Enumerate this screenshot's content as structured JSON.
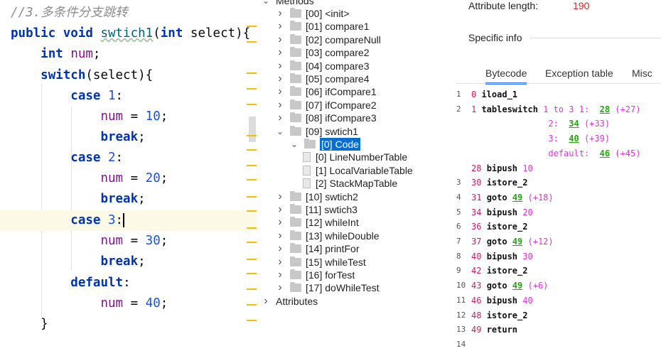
{
  "editor": {
    "lines": [
      [
        {
          "t": "//3.多条件分支跳转",
          "c": "cm"
        }
      ],
      [
        {
          "t": "public ",
          "c": "kw"
        },
        {
          "t": "void ",
          "c": "kw"
        },
        {
          "t": "swtich1",
          "c": "fn"
        },
        {
          "t": "(",
          "c": "plain"
        },
        {
          "t": "int ",
          "c": "kw"
        },
        {
          "t": "select){",
          "c": "plain"
        }
      ],
      [
        {
          "t": "    ",
          "c": "plain"
        },
        {
          "t": "int ",
          "c": "kw"
        },
        {
          "t": "num",
          "c": "var"
        },
        {
          "t": ";",
          "c": "plain"
        }
      ],
      [
        {
          "t": "    ",
          "c": "plain"
        },
        {
          "t": "switch",
          "c": "kw"
        },
        {
          "t": "(select){",
          "c": "plain"
        }
      ],
      [
        {
          "t": "        ",
          "c": "plain"
        },
        {
          "t": "case ",
          "c": "kw"
        },
        {
          "t": "1",
          "c": "num"
        },
        {
          "t": ":",
          "c": "plain"
        }
      ],
      [
        {
          "t": "            ",
          "c": "plain"
        },
        {
          "t": "num",
          "c": "var"
        },
        {
          "t": " = ",
          "c": "plain"
        },
        {
          "t": "10",
          "c": "num"
        },
        {
          "t": ";",
          "c": "plain"
        }
      ],
      [
        {
          "t": "            ",
          "c": "plain"
        },
        {
          "t": "break",
          "c": "kw"
        },
        {
          "t": ";",
          "c": "plain"
        }
      ],
      [
        {
          "t": "        ",
          "c": "plain"
        },
        {
          "t": "case ",
          "c": "kw"
        },
        {
          "t": "2",
          "c": "num"
        },
        {
          "t": ":",
          "c": "plain"
        }
      ],
      [
        {
          "t": "            ",
          "c": "plain"
        },
        {
          "t": "num",
          "c": "var"
        },
        {
          "t": " = ",
          "c": "plain"
        },
        {
          "t": "20",
          "c": "num"
        },
        {
          "t": ";",
          "c": "plain"
        }
      ],
      [
        {
          "t": "            ",
          "c": "plain"
        },
        {
          "t": "break",
          "c": "kw"
        },
        {
          "t": ";",
          "c": "plain"
        }
      ],
      [
        {
          "t": "        ",
          "c": "plain"
        },
        {
          "t": "case ",
          "c": "kw"
        },
        {
          "t": "3",
          "c": "num"
        },
        {
          "t": ":",
          "c": "plain"
        }
      ],
      [
        {
          "t": "            ",
          "c": "plain"
        },
        {
          "t": "num",
          "c": "var"
        },
        {
          "t": " = ",
          "c": "plain"
        },
        {
          "t": "30",
          "c": "num"
        },
        {
          "t": ";",
          "c": "plain"
        }
      ],
      [
        {
          "t": "            ",
          "c": "plain"
        },
        {
          "t": "break",
          "c": "kw"
        },
        {
          "t": ";",
          "c": "plain"
        }
      ],
      [
        {
          "t": "        ",
          "c": "plain"
        },
        {
          "t": "default",
          "c": "kw"
        },
        {
          "t": ":",
          "c": "plain"
        }
      ],
      [
        {
          "t": "            ",
          "c": "plain"
        },
        {
          "t": "num",
          "c": "var"
        },
        {
          "t": " = ",
          "c": "plain"
        },
        {
          "t": "40",
          "c": "num"
        },
        {
          "t": ";",
          "c": "plain"
        }
      ],
      [
        {
          "t": "    }",
          "c": "plain"
        }
      ]
    ],
    "current_line": 10
  },
  "tree": {
    "header": "Methods",
    "items": [
      {
        "label": "[00] <init>",
        "level": 1,
        "kind": "folder",
        "state": "collapsed"
      },
      {
        "label": "[01] compare1",
        "level": 1,
        "kind": "folder",
        "state": "collapsed"
      },
      {
        "label": "[02] compareNull",
        "level": 1,
        "kind": "folder",
        "state": "collapsed"
      },
      {
        "label": "[03] compare2",
        "level": 1,
        "kind": "folder",
        "state": "collapsed"
      },
      {
        "label": "[04] compare3",
        "level": 1,
        "kind": "folder",
        "state": "collapsed"
      },
      {
        "label": "[05] compare4",
        "level": 1,
        "kind": "folder",
        "state": "collapsed"
      },
      {
        "label": "[06] ifCompare1",
        "level": 1,
        "kind": "folder",
        "state": "collapsed"
      },
      {
        "label": "[07] ifCompare2",
        "level": 1,
        "kind": "folder",
        "state": "collapsed"
      },
      {
        "label": "[08] ifCompare3",
        "level": 1,
        "kind": "folder",
        "state": "collapsed"
      },
      {
        "label": "[09] swtich1",
        "level": 1,
        "kind": "folder",
        "state": "expanded"
      },
      {
        "label": "[0] Code",
        "level": 2,
        "kind": "folder",
        "state": "expanded",
        "selected": true
      },
      {
        "label": "[0] LineNumberTable",
        "level": 3,
        "kind": "doc",
        "state": "leaf"
      },
      {
        "label": "[1] LocalVariableTable",
        "level": 3,
        "kind": "doc",
        "state": "leaf"
      },
      {
        "label": "[2] StackMapTable",
        "level": 3,
        "kind": "doc",
        "state": "leaf"
      },
      {
        "label": "[10] swtich2",
        "level": 1,
        "kind": "folder",
        "state": "collapsed"
      },
      {
        "label": "[11] swtich3",
        "level": 1,
        "kind": "folder",
        "state": "collapsed"
      },
      {
        "label": "[12] whileInt",
        "level": 1,
        "kind": "folder",
        "state": "collapsed"
      },
      {
        "label": "[13] whileDouble",
        "level": 1,
        "kind": "folder",
        "state": "collapsed"
      },
      {
        "label": "[14] printFor",
        "level": 1,
        "kind": "folder",
        "state": "collapsed"
      },
      {
        "label": "[15] whileTest",
        "level": 1,
        "kind": "folder",
        "state": "collapsed"
      },
      {
        "label": "[16] forTest",
        "level": 1,
        "kind": "folder",
        "state": "collapsed"
      },
      {
        "label": "[17] doWhileTest",
        "level": 1,
        "kind": "folder",
        "state": "collapsed"
      },
      {
        "label": "Attributes",
        "level": 0,
        "kind": "none",
        "state": "collapsed"
      }
    ]
  },
  "details": {
    "attribute_length_label": "Attribute length:",
    "attribute_length_value": "190",
    "specific_info_label": "Specific info",
    "tabs": [
      "Bytecode",
      "Exception table",
      "Misc"
    ],
    "active_tab": "Bytecode",
    "bytecode": [
      {
        "ln": "1",
        "parts": [
          {
            "t": "0 ",
            "c": "off"
          },
          {
            "t": "iload_1",
            "c": "op"
          }
        ]
      },
      {
        "ln": "2",
        "parts": [
          {
            "t": "1 ",
            "c": "off"
          },
          {
            "t": "tableswitch ",
            "c": "op"
          },
          {
            "t": "1 to 3 1:  ",
            "c": "arg"
          },
          {
            "t": "28",
            "c": "lnk"
          },
          {
            "t": " (+27)",
            "c": "rel"
          }
        ]
      },
      {
        "ln": "",
        "parts": [
          {
            "t": "               2:  ",
            "c": "arg"
          },
          {
            "t": "34",
            "c": "lnk"
          },
          {
            "t": " (+33)",
            "c": "rel"
          }
        ]
      },
      {
        "ln": "",
        "parts": [
          {
            "t": "               3:  ",
            "c": "arg"
          },
          {
            "t": "40",
            "c": "lnk"
          },
          {
            "t": " (+39)",
            "c": "rel"
          }
        ]
      },
      {
        "ln": "",
        "parts": [
          {
            "t": "               default:  ",
            "c": "arg"
          },
          {
            "t": "46",
            "c": "lnk"
          },
          {
            "t": " (+45)",
            "c": "rel"
          }
        ]
      },
      {
        "ln": "",
        "parts": [
          {
            "t": "28 ",
            "c": "off"
          },
          {
            "t": "bipush ",
            "c": "op"
          },
          {
            "t": "10",
            "c": "arg"
          }
        ]
      },
      {
        "ln": "3",
        "parts": [
          {
            "t": "30 ",
            "c": "off"
          },
          {
            "t": "istore_2",
            "c": "op"
          }
        ]
      },
      {
        "ln": "4",
        "parts": [
          {
            "t": "31 ",
            "c": "off"
          },
          {
            "t": "goto ",
            "c": "op"
          },
          {
            "t": "49",
            "c": "lnk"
          },
          {
            "t": " (+18)",
            "c": "rel"
          }
        ]
      },
      {
        "ln": "5",
        "parts": [
          {
            "t": "34 ",
            "c": "off"
          },
          {
            "t": "bipush ",
            "c": "op"
          },
          {
            "t": "20",
            "c": "arg"
          }
        ]
      },
      {
        "ln": "6",
        "parts": [
          {
            "t": "36 ",
            "c": "off"
          },
          {
            "t": "istore_2",
            "c": "op"
          }
        ]
      },
      {
        "ln": "7",
        "parts": [
          {
            "t": "37 ",
            "c": "off"
          },
          {
            "t": "goto ",
            "c": "op"
          },
          {
            "t": "49",
            "c": "lnk"
          },
          {
            "t": " (+12)",
            "c": "rel"
          }
        ]
      },
      {
        "ln": "8",
        "parts": [
          {
            "t": "40 ",
            "c": "off"
          },
          {
            "t": "bipush ",
            "c": "op"
          },
          {
            "t": "30",
            "c": "arg"
          }
        ]
      },
      {
        "ln": "9",
        "parts": [
          {
            "t": "42 ",
            "c": "off"
          },
          {
            "t": "istore_2",
            "c": "op"
          }
        ]
      },
      {
        "ln": "10",
        "parts": [
          {
            "t": "43 ",
            "c": "off"
          },
          {
            "t": "goto ",
            "c": "op"
          },
          {
            "t": "49",
            "c": "lnk"
          },
          {
            "t": " (+6)",
            "c": "rel"
          }
        ]
      },
      {
        "ln": "11",
        "parts": [
          {
            "t": "46 ",
            "c": "off"
          },
          {
            "t": "bipush ",
            "c": "op"
          },
          {
            "t": "40",
            "c": "arg"
          }
        ]
      },
      {
        "ln": "12",
        "parts": [
          {
            "t": "48 ",
            "c": "off"
          },
          {
            "t": "istore_2",
            "c": "op"
          }
        ]
      },
      {
        "ln": "13",
        "parts": [
          {
            "t": "49 ",
            "c": "off"
          },
          {
            "t": "return",
            "c": "op"
          }
        ]
      },
      {
        "ln": "14",
        "parts": []
      }
    ]
  },
  "colors": {
    "selection": "#0a6ed1",
    "keyword": "#0033b3",
    "number": "#1750eb",
    "variable": "#871094",
    "offset": "#d21c6b",
    "jump_link": "#22a70c",
    "attr_value": "#cc2a2a",
    "active_tab": "#3574f0"
  },
  "icons": {
    "collapsed": "chevron-right-icon",
    "expanded": "chevron-down-icon",
    "folder": "folder-icon",
    "leaf": "file-icon"
  }
}
